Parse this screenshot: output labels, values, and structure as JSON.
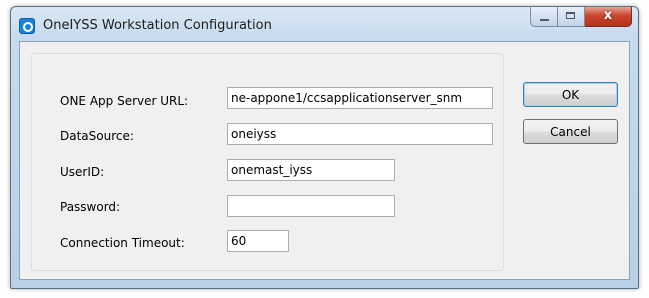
{
  "window": {
    "title": "OneIYSS Workstation Configuration",
    "icon": "app-icon",
    "caption_buttons": {
      "minimize": "minimize-icon",
      "maximize": "maximize-icon",
      "close": "x"
    }
  },
  "form": {
    "fields": [
      {
        "label": "ONE App Server URL:",
        "value": "ne-appone1/ccsapplicationserver_snm"
      },
      {
        "label": "DataSource:",
        "value": "oneiyss"
      },
      {
        "label": "UserID:",
        "value": "onemast_iyss"
      },
      {
        "label": "Password:",
        "value": ""
      },
      {
        "label": "Connection Timeout:",
        "value": "60"
      }
    ]
  },
  "buttons": {
    "ok_label": "OK",
    "cancel_label": "Cancel"
  },
  "colors": {
    "title_bar": "#c7dbee",
    "close_button": "#c9462c",
    "dialog_background": "#f0f0f0"
  }
}
